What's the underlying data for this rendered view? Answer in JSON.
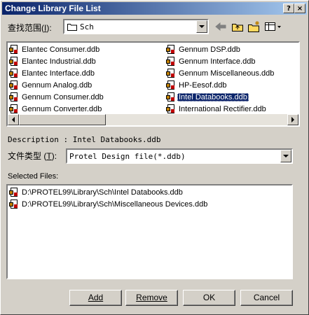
{
  "window": {
    "title": "Change Library File List",
    "help_label": "?",
    "close_label": "×"
  },
  "lookin": {
    "label": "查找范围",
    "accel": "I",
    "value": "Sch"
  },
  "toolbar": {
    "back": "back-arrow",
    "up": "up-folder",
    "newfolder": "new-folder",
    "view": "view-menu"
  },
  "files_left": [
    "Elantec Consumer.ddb",
    "Elantec Industrial.ddb",
    "Elantec Interface.ddb",
    "Gennum Analog.ddb",
    "Gennum Consumer.ddb",
    "Gennum Converter.ddb"
  ],
  "files_right": [
    "Gennum DSP.ddb",
    "Gennum Interface.ddb",
    "Gennum Miscellaneous.ddb",
    "HP-Eesof.ddb",
    "Intel Databooks.ddb",
    "International Rectifier.ddb"
  ],
  "selected_index_right": 4,
  "description": "Description : Intel Databooks.ddb",
  "filetype": {
    "label": "文件类型",
    "accel": "T",
    "value": "Protel Design file(*.ddb)"
  },
  "selected_files": {
    "label": "Selected Files:",
    "items": [
      "D:\\PROTEL99\\Library\\Sch\\Intel Databooks.ddb",
      "D:\\PROTEL99\\Library\\Sch\\Miscellaneous Devices.ddb"
    ]
  },
  "buttons": {
    "add": "Add",
    "remove": "Remove",
    "ok": "OK",
    "cancel": "Cancel"
  }
}
